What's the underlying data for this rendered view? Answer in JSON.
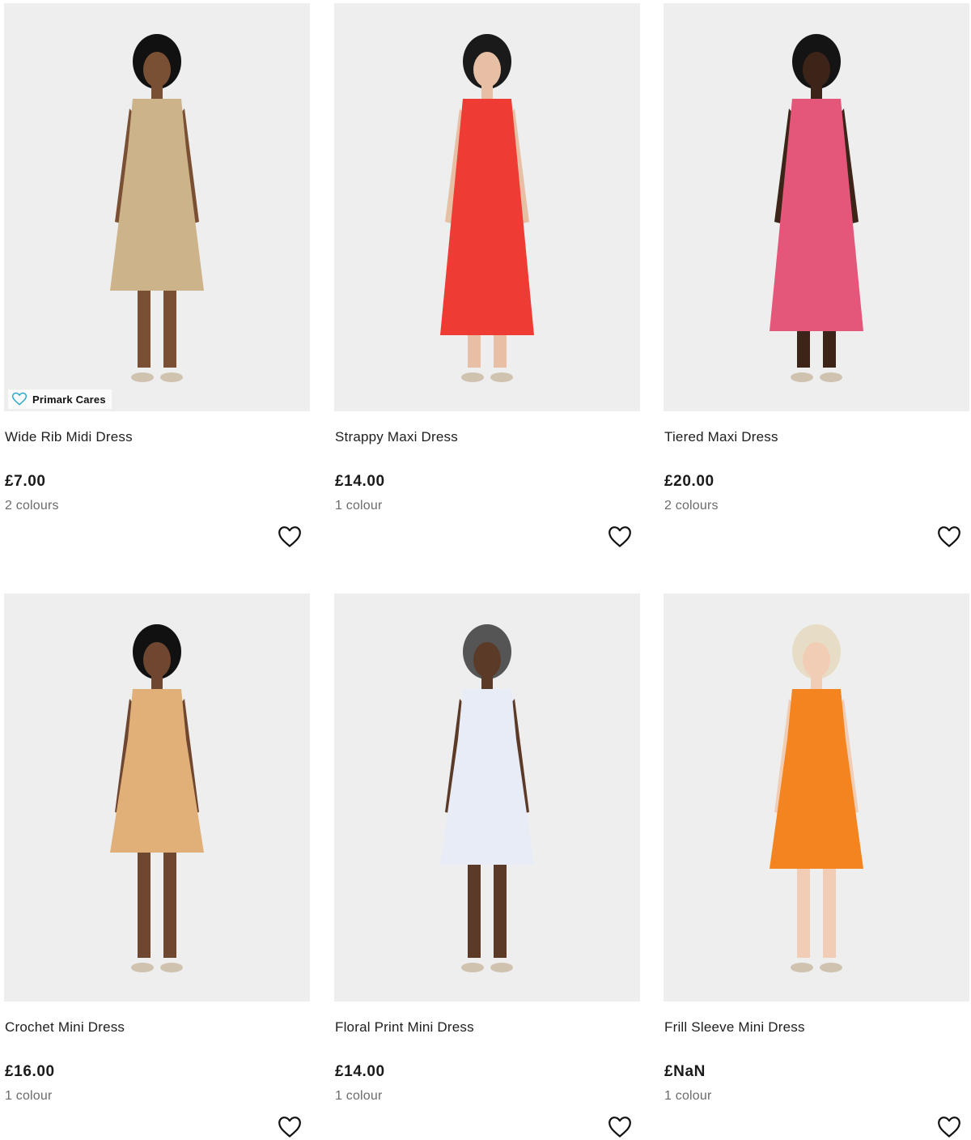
{
  "products": [
    {
      "title": "Wide Rib Midi Dress",
      "price": "£7.00",
      "colours": "2 colours",
      "badge": "Primark Cares",
      "dress_color": "#cdb38a",
      "skin_color": "#7a5034",
      "hair_color": "#111111"
    },
    {
      "title": "Strappy Maxi Dress",
      "price": "£14.00",
      "colours": "1 colour",
      "dress_color": "#ee3b33",
      "skin_color": "#e6bfa5",
      "hair_color": "#1a1a1a"
    },
    {
      "title": "Tiered Maxi Dress",
      "price": "£20.00",
      "colours": "2 colours",
      "dress_color": "#e4577a",
      "skin_color": "#3c2418",
      "hair_color": "#141414"
    },
    {
      "title": "Crochet Mini Dress",
      "price": "£16.00",
      "colours": "1 colour",
      "dress_color": "#e1b078",
      "skin_color": "#6f4630",
      "hair_color": "#111111"
    },
    {
      "title": "Floral Print Mini Dress",
      "price": "£14.00",
      "colours": "1 colour",
      "dress_color": "#e7ecf6",
      "skin_color": "#5b3a28",
      "hair_color": "#555555"
    },
    {
      "title": "Frill Sleeve Mini Dress",
      "price": "£NaN",
      "colours": "1 colour",
      "dress_color": "#f3841f",
      "skin_color": "#f1cdb6",
      "hair_color": "#e7dcc5"
    }
  ],
  "icons": {
    "wishlist": "heart-outline-icon",
    "badge": "heart-badge-icon"
  },
  "colors": {
    "badge_heart": "#28a8c8",
    "image_bg": "#eeeeee",
    "price_text": "#1a1a1a",
    "secondary_text": "#6b6b6b"
  }
}
